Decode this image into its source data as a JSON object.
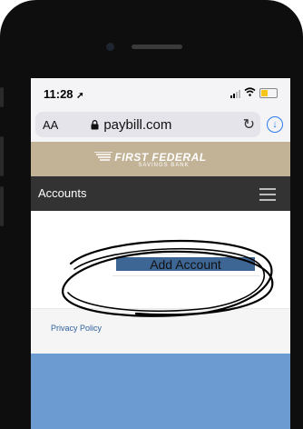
{
  "status": {
    "time": "11:28"
  },
  "browser": {
    "aa_label": "AA",
    "url": "paybill.com"
  },
  "bank": {
    "name": "FIRST FEDERAL",
    "subtitle": "SAVINGS BANK"
  },
  "nav": {
    "title": "Accounts"
  },
  "main": {
    "add_account_label": "Add Account"
  },
  "footer": {
    "privacy_label": "Privacy Policy"
  },
  "colors": {
    "logo_bar": "#c2b296",
    "nav_bar": "#333333",
    "button": "#3e6694",
    "page_bottom": "#6b9bd1",
    "link": "#2c5f9e"
  },
  "icons": [
    "location-arrow-icon",
    "signal-icon",
    "wifi-icon",
    "battery-icon",
    "lock-icon",
    "reload-icon",
    "download-icon",
    "flag-logo-icon",
    "hamburger-menu-icon",
    "hand-drawn-circle-annotation"
  ]
}
